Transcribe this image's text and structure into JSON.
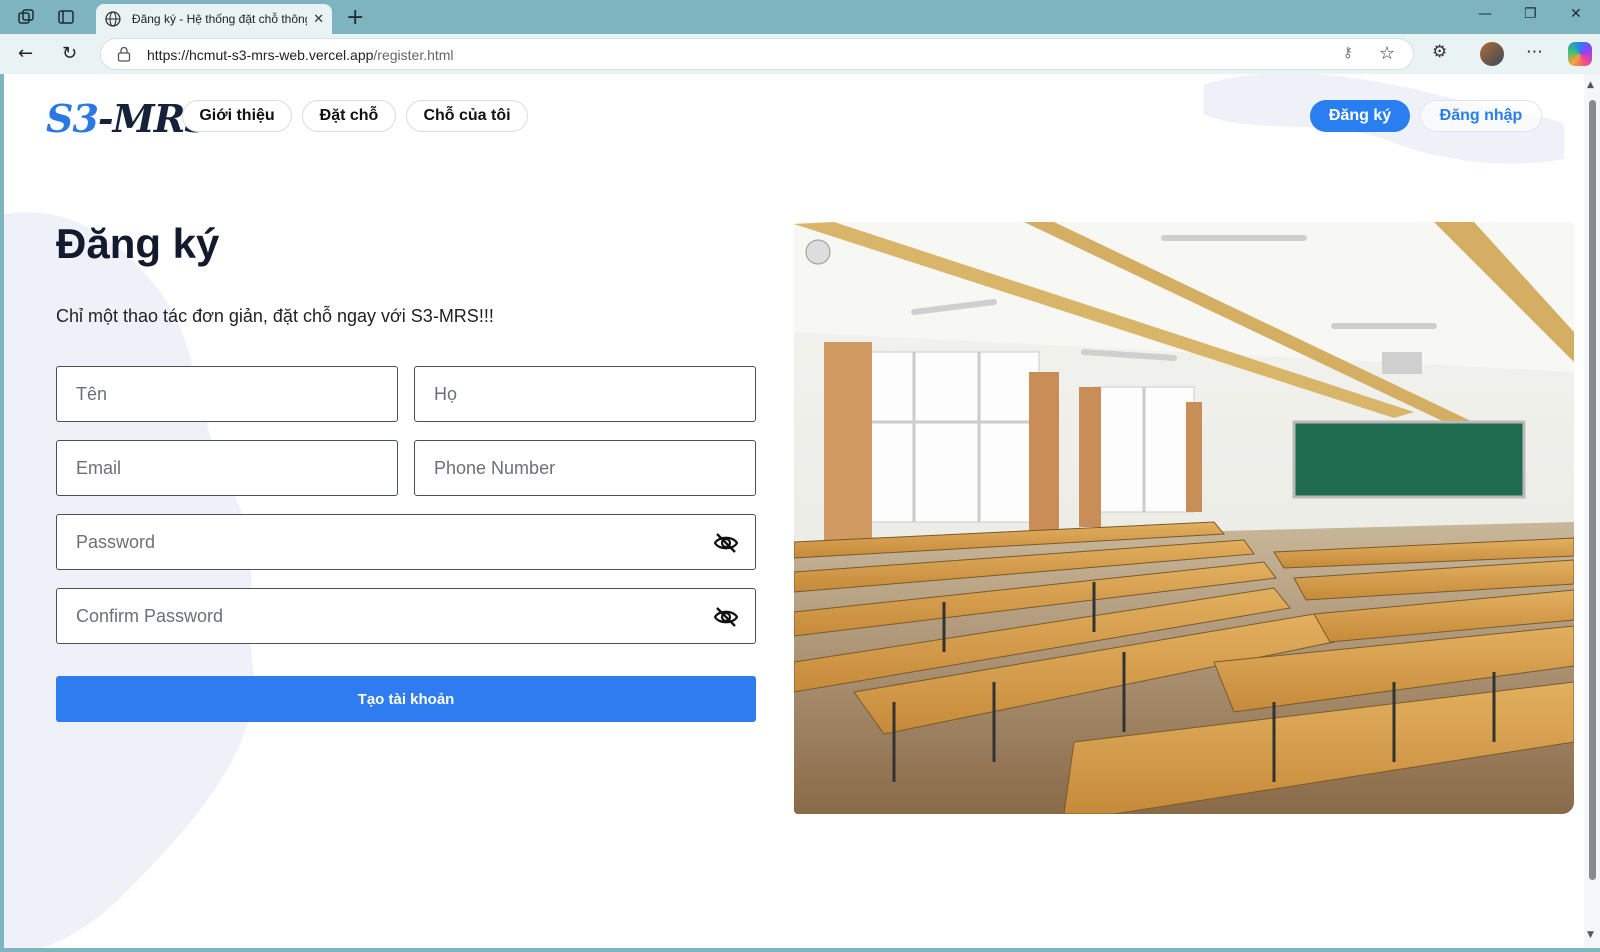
{
  "browser": {
    "tab_title": "Đăng ký - Hệ thống đặt chỗ thông minh",
    "url_host": "https://hcmut-s3-mrs-web.vercel.app",
    "url_path": "/register.html"
  },
  "nav": {
    "logo_prefix": "S3",
    "logo_suffix": "-MRS",
    "items": [
      "Giới thiệu",
      "Đặt chỗ",
      "Chỗ của tôi"
    ],
    "register_label": "Đăng ký",
    "login_label": "Đăng nhập"
  },
  "form": {
    "title": "Đăng ký",
    "subtitle": "Chỉ một thao tác đơn giản, đặt chỗ ngay với S3-MRS!!!",
    "first_name_placeholder": "Tên",
    "last_name_placeholder": "Họ",
    "email_placeholder": "Email",
    "phone_placeholder": "Phone Number",
    "password_placeholder": "Password",
    "confirm_password_placeholder": "Confirm Password",
    "submit_label": "Tạo tài khoản"
  },
  "colors": {
    "accent": "#2f7cf0",
    "title": "#141a2e",
    "browser_frame": "#7db4bf"
  }
}
